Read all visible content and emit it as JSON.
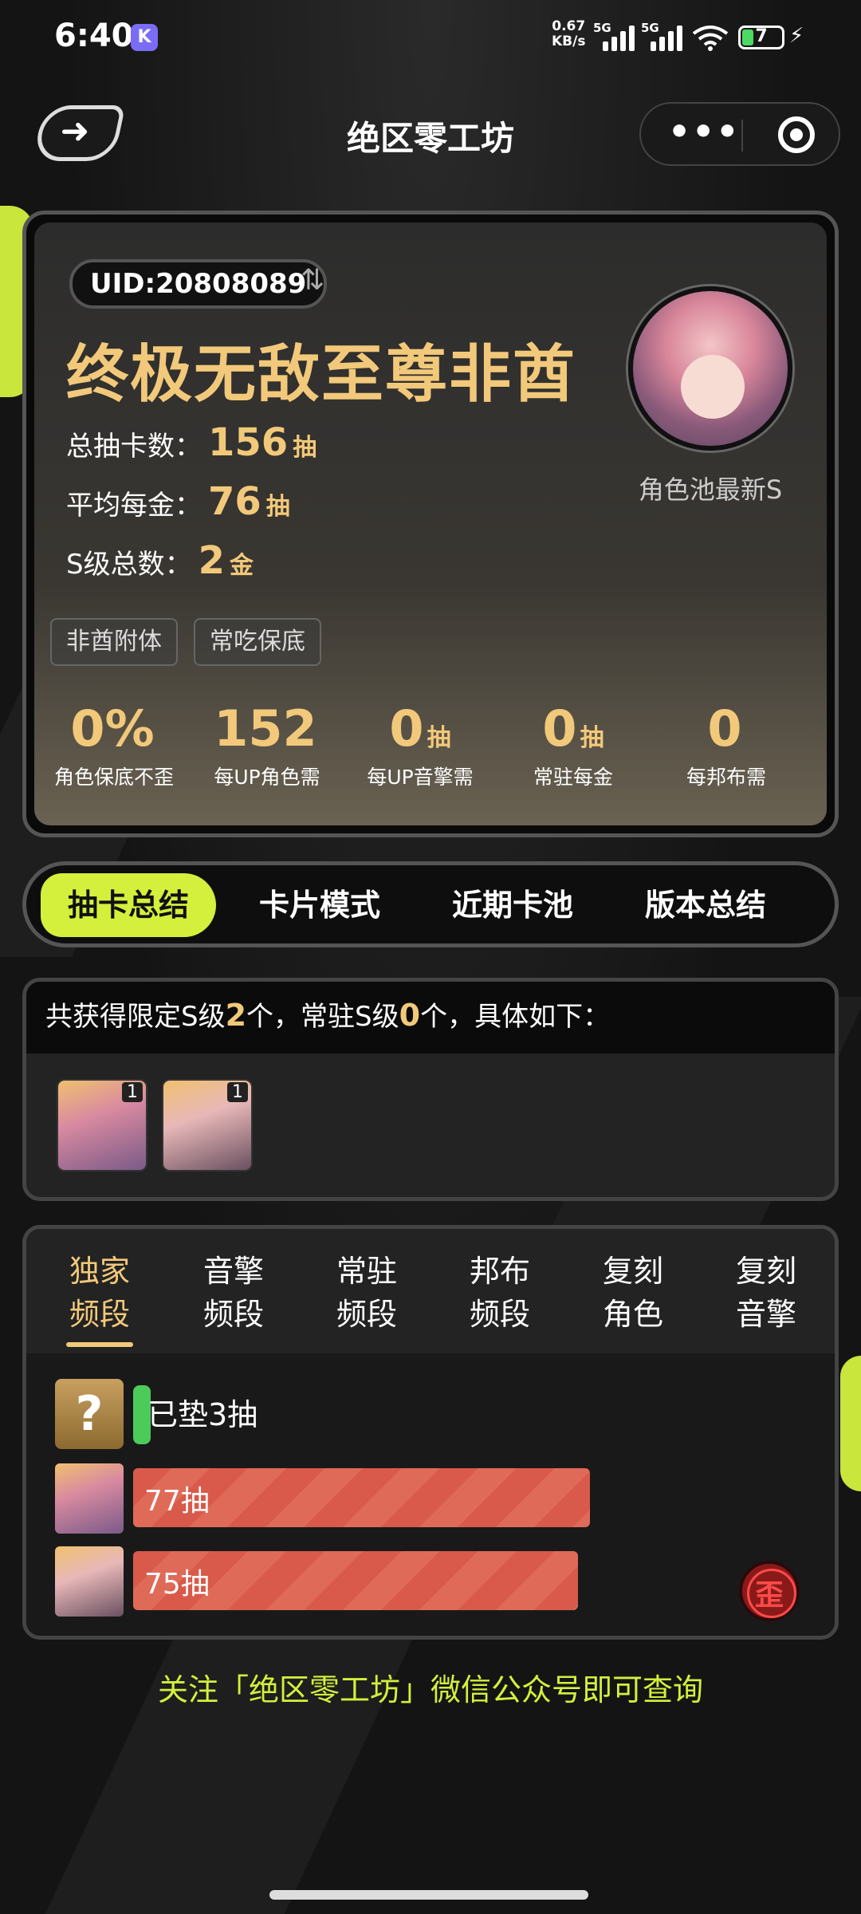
{
  "status_bar": {
    "time": "6:40",
    "app_badge": "K",
    "net_speed_value": "0.67",
    "net_speed_unit": "KB/s",
    "signal_1": "5G",
    "signal_2": "5G",
    "battery": "7"
  },
  "nav": {
    "title": "绝区零工坊",
    "back_icon": "arrow-left-icon",
    "more_icon": "more-dots-icon",
    "close_icon": "target-circle-icon"
  },
  "profile": {
    "uid": "UID:20808089",
    "title": "终极无敌至尊非酋",
    "stats": [
      {
        "label": "总抽卡数：",
        "value": "156",
        "unit": "抽"
      },
      {
        "label": "平均每金：",
        "value": "76",
        "unit": "抽"
      },
      {
        "label": "S级总数：",
        "value": "2",
        "unit": "金"
      }
    ],
    "avatar_caption": "角色池最新S",
    "tags": [
      "非酋附体",
      "常吃保底"
    ],
    "metrics": [
      {
        "value": "0%",
        "unit": "",
        "label": "角色保底不歪"
      },
      {
        "value": "152",
        "unit": "",
        "label": "每UP角色需"
      },
      {
        "value": "0",
        "unit": "抽",
        "label": "每UP音擎需"
      },
      {
        "value": "0",
        "unit": "抽",
        "label": "常驻每金"
      },
      {
        "value": "0",
        "unit": "",
        "label": "每邦布需"
      }
    ]
  },
  "tabs": [
    "抽卡总结",
    "卡片模式",
    "近期卡池",
    "版本总结"
  ],
  "summary": {
    "prefix": "共获得限定S级",
    "limited_count": "2",
    "middle": "个，常驻S级",
    "standard_count": "0",
    "suffix": "个，具体如下：",
    "characters": [
      {
        "count": "1"
      },
      {
        "count": "1"
      }
    ]
  },
  "pool_tabs": [
    {
      "line1": "独家",
      "line2": "频段"
    },
    {
      "line1": "音擎",
      "line2": "频段"
    },
    {
      "line1": "常驻",
      "line2": "频段"
    },
    {
      "line1": "邦布",
      "line2": "频段"
    },
    {
      "line1": "复刻",
      "line2": "角色"
    },
    {
      "line1": "复刻",
      "line2": "音擎"
    }
  ],
  "pity": {
    "question_mark": "?",
    "text": "已垫3抽"
  },
  "pull_rows": [
    {
      "label": "77抽",
      "pulls": 77
    },
    {
      "label": "75抽",
      "pulls": 75
    }
  ],
  "lost_badge": "歪",
  "footer": "关注「绝区零工坊」微信公众号即可查询",
  "colors": {
    "accent_lime": "#d4f03c",
    "gold": "#f2c97a",
    "bar_red": "#d95a4a",
    "green": "#4ccb5a"
  }
}
